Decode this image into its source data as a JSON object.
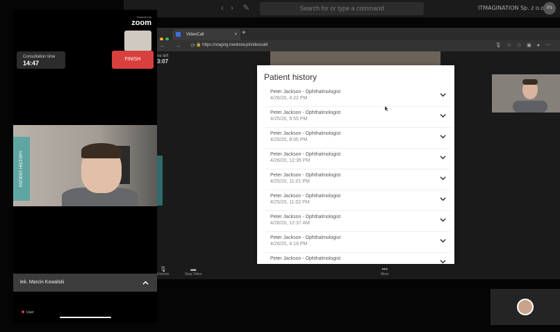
{
  "zoom_toolbar": {
    "search_placeholder": "Search for or type a command",
    "org_name": "ITMAGINATION Sp. z o.o.",
    "avatar_initials": "PS"
  },
  "browser": {
    "tab_title": "VideoCall",
    "url": "https://staging.mednow.pl/videocall/",
    "time_left_label": "ne left",
    "time_left_value": "3:07"
  },
  "modal": {
    "title": "Patient history",
    "items": [
      {
        "doctor": "Peter Jackson - Ophthalmologist",
        "date": "4/26/20, 4:22 PM"
      },
      {
        "doctor": "Peter Jackson - Ophthalmologist",
        "date": "4/25/20, 8:55 PM"
      },
      {
        "doctor": "Peter Jackson - Ophthalmologist",
        "date": "4/25/20, 8:05 PM"
      },
      {
        "doctor": "Peter Jackson - Ophthalmologist",
        "date": "4/26/20, 12:35 PM"
      },
      {
        "doctor": "Peter Jackson - Ophthalmologist",
        "date": "4/25/20, 11:01 PM"
      },
      {
        "doctor": "Peter Jackson - Ophthalmologist",
        "date": "4/25/20, 11:02 PM"
      },
      {
        "doctor": "Peter Jackson - Ophthalmologist",
        "date": "4/26/20, 12:37 AM"
      },
      {
        "doctor": "Peter Jackson - Ophthalmologist",
        "date": "4/26/20, 4:19 PM"
      },
      {
        "doctor": "Peter Jackson - Ophthalmologist",
        "date": ""
      }
    ]
  },
  "zoom_controls": {
    "unmute": "Unmute",
    "stop_video": "Stop Video",
    "more": "More"
  },
  "phone": {
    "powered_by": "Powered by",
    "logo": "zoom",
    "consultation_label": "Consultation time",
    "consultation_value": "14:47",
    "finish_label": "FINISH",
    "patient_history_tab": "PATIENT HISTORY",
    "doctor_name": "lek. Marcin Kowalski",
    "user_label": "User"
  },
  "colors": {
    "finish": "#d8403e",
    "patient_history_tab": "#5fa6a2",
    "modal_bg": "#ffffff"
  }
}
